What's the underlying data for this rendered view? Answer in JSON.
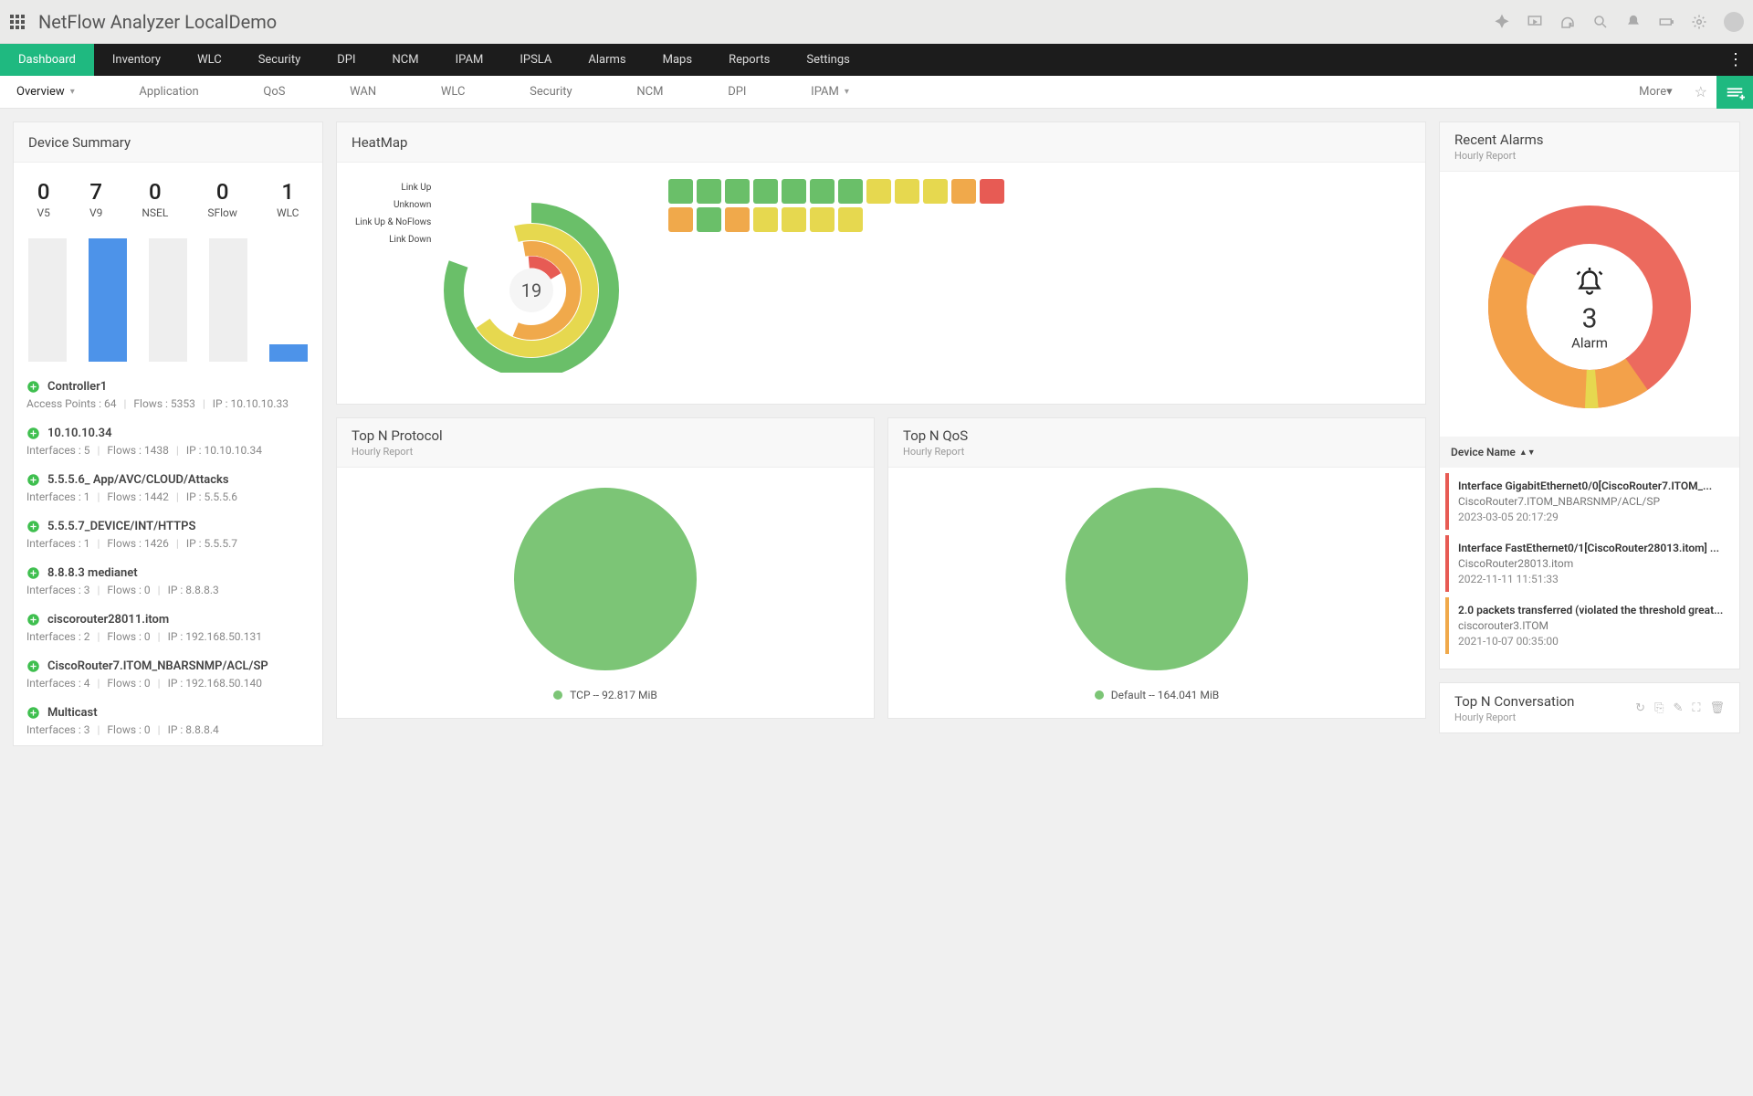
{
  "app": {
    "title": "NetFlow Analyzer LocalDemo"
  },
  "mainnav": [
    "Dashboard",
    "Inventory",
    "WLC",
    "Security",
    "DPI",
    "NCM",
    "IPAM",
    "IPSLA",
    "Alarms",
    "Maps",
    "Reports",
    "Settings"
  ],
  "subnav": {
    "items": [
      "Overview",
      "Application",
      "QoS",
      "WAN",
      "WLC",
      "Security",
      "NCM",
      "DPI",
      "IPAM"
    ],
    "more": "More"
  },
  "device_summary": {
    "title": "Device Summary",
    "stats": [
      {
        "n": "0",
        "l": "V5"
      },
      {
        "n": "7",
        "l": "V9"
      },
      {
        "n": "0",
        "l": "NSEL"
      },
      {
        "n": "0",
        "l": "SFlow"
      },
      {
        "n": "1",
        "l": "WLC"
      }
    ],
    "devices": [
      {
        "name": "Controller1",
        "meta": [
          {
            "k": "Access Points",
            "v": "64"
          },
          {
            "k": "Flows",
            "v": "5353"
          },
          {
            "k": "IP",
            "v": "10.10.10.33"
          }
        ]
      },
      {
        "name": "10.10.10.34",
        "meta": [
          {
            "k": "Interfaces",
            "v": "5"
          },
          {
            "k": "Flows",
            "v": "1438"
          },
          {
            "k": "IP",
            "v": "10.10.10.34"
          }
        ]
      },
      {
        "name": "5.5.5.6_ App/AVC/CLOUD/Attacks",
        "meta": [
          {
            "k": "Interfaces",
            "v": "1"
          },
          {
            "k": "Flows",
            "v": "1442"
          },
          {
            "k": "IP",
            "v": "5.5.5.6"
          }
        ]
      },
      {
        "name": "5.5.5.7_DEVICE/INT/HTTPS",
        "meta": [
          {
            "k": "Interfaces",
            "v": "1"
          },
          {
            "k": "Flows",
            "v": "1426"
          },
          {
            "k": "IP",
            "v": "5.5.5.7"
          }
        ]
      },
      {
        "name": "8.8.8.3 medianet",
        "meta": [
          {
            "k": "Interfaces",
            "v": "3"
          },
          {
            "k": "Flows",
            "v": "0"
          },
          {
            "k": "IP",
            "v": "8.8.8.3"
          }
        ]
      },
      {
        "name": "ciscorouter28011.itom",
        "meta": [
          {
            "k": "Interfaces",
            "v": "2"
          },
          {
            "k": "Flows",
            "v": "0"
          },
          {
            "k": "IP",
            "v": "192.168.50.131"
          }
        ]
      },
      {
        "name": "CiscoRouter7.ITOM_NBARSNMP/ACL/SP",
        "meta": [
          {
            "k": "Interfaces",
            "v": "4"
          },
          {
            "k": "Flows",
            "v": "0"
          },
          {
            "k": "IP",
            "v": "192.168.50.140"
          }
        ]
      },
      {
        "name": "Multicast",
        "meta": [
          {
            "k": "Interfaces",
            "v": "3"
          },
          {
            "k": "Flows",
            "v": "0"
          },
          {
            "k": "IP",
            "v": "8.8.8.4"
          }
        ]
      }
    ]
  },
  "heatmap": {
    "title": "HeatMap",
    "labels": [
      "Link Up",
      "Unknown",
      "Link Up & NoFlows",
      "Link Down"
    ],
    "center": "19",
    "cells": [
      "g",
      "g",
      "g",
      "g",
      "g",
      "g",
      "g",
      "y",
      "y",
      "y",
      "o",
      "r",
      "o",
      "g",
      "o",
      "y",
      "y",
      "y",
      "y"
    ],
    "colors": {
      "g": "#6abf69",
      "y": "#e6d84f",
      "o": "#f0a94b",
      "r": "#e75b54"
    }
  },
  "top_protocol": {
    "title": "Top N Protocol",
    "sub": "Hourly Report",
    "legend": "TCP -- 92.817 MiB"
  },
  "top_qos": {
    "title": "Top N QoS",
    "sub": "Hourly Report",
    "legend": "Default -- 164.041 MiB"
  },
  "recent_alarms": {
    "title": "Recent Alarms",
    "sub": "Hourly Report",
    "count": "3",
    "label": "Alarm",
    "list_head": "Device Name",
    "items": [
      {
        "c": "#e75b54",
        "t": "Interface GigabitEthernet0/0[CiscoRouter7.ITOM_...",
        "s": "CiscoRouter7.ITOM_NBARSNMP/ACL/SP",
        "d": "2023-03-05 20:17:29"
      },
      {
        "c": "#e75b54",
        "t": "Interface FastEthernet0/1[CiscoRouter28013.itom] ...",
        "s": "CiscoRouter28013.itom",
        "d": "2022-11-11 11:51:33"
      },
      {
        "c": "#f0a94b",
        "t": "2.0 packets transferred (violated the threshold great...",
        "s": "ciscorouter3.ITOM",
        "d": "2021-10-07 00:35:00"
      }
    ]
  },
  "top_conv": {
    "title": "Top N Conversation",
    "sub": "Hourly Report"
  },
  "chart_data": [
    {
      "type": "bar",
      "title": "Device Summary",
      "categories": [
        "V5",
        "V9",
        "NSEL",
        "SFlow",
        "WLC"
      ],
      "values": [
        0,
        7,
        0,
        0,
        1
      ],
      "ylim": [
        0,
        8
      ]
    },
    {
      "type": "pie",
      "title": "HeatMap radial (interface status out of 19)",
      "categories": [
        "Link Up (green)",
        "Unknown (yellow)",
        "Link Up & NoFlows (orange)",
        "Link Down (red)"
      ],
      "values": [
        8,
        7,
        3,
        1
      ]
    },
    {
      "type": "pie",
      "title": "Top N Protocol",
      "categories": [
        "TCP"
      ],
      "values": [
        92.817
      ],
      "unit": "MiB"
    },
    {
      "type": "pie",
      "title": "Top N QoS",
      "categories": [
        "Default"
      ],
      "values": [
        164.041
      ],
      "unit": "MiB"
    },
    {
      "type": "pie",
      "title": "Recent Alarms donut",
      "categories": [
        "Red",
        "Orange",
        "Yellow"
      ],
      "values": [
        55,
        43,
        2
      ],
      "unit": "percent_ring"
    }
  ]
}
